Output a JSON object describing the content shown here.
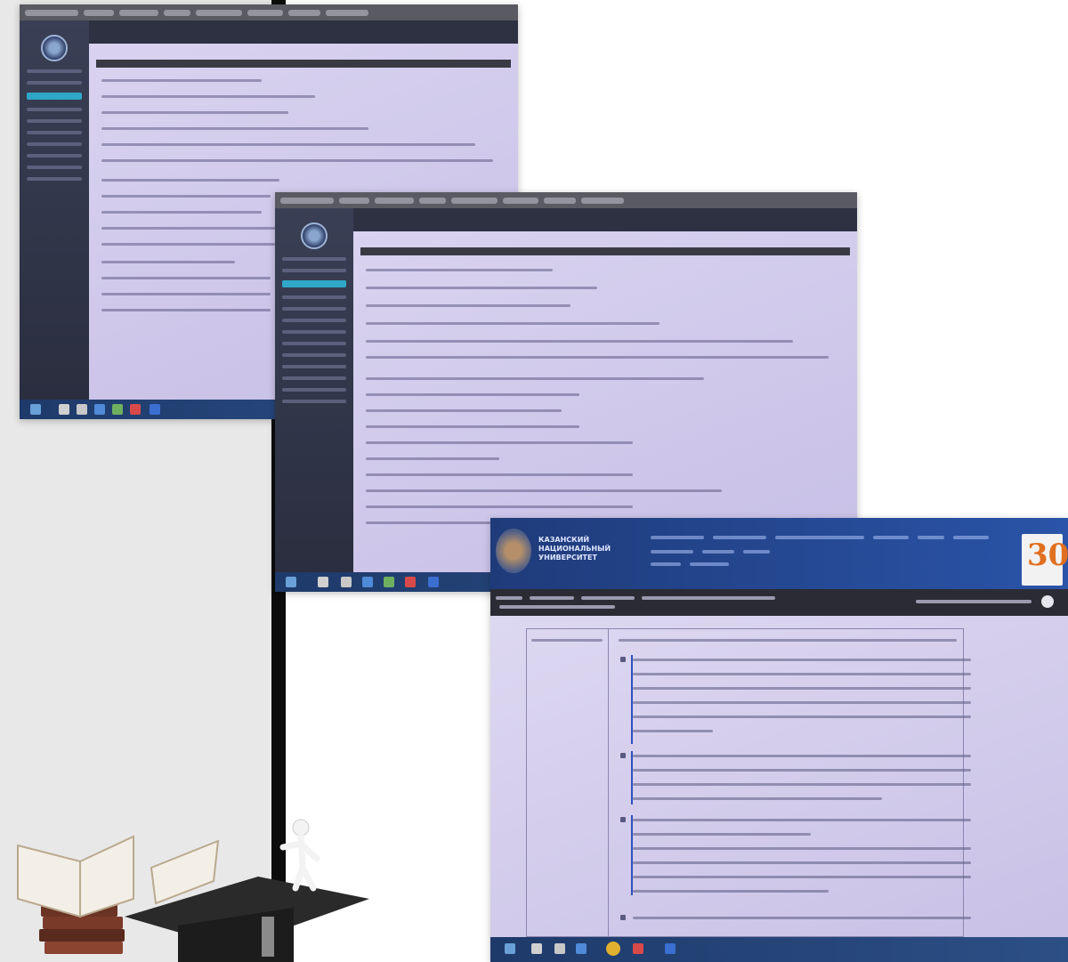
{
  "screens": [
    {
      "type": "lms-page",
      "browser_tabs": 8
    },
    {
      "type": "lms-page",
      "browser_tabs": 8
    },
    {
      "type": "university-site",
      "header": {
        "name_line1": "КАЗАНСКИЙ",
        "name_line2": "НАЦИОНАЛЬНЫЙ",
        "name_line3": "УНИВЕРСИТЕТ",
        "anniversary_number": "30"
      }
    }
  ],
  "colors": {
    "screen_tint": "#cdc6ea",
    "uni_header": "#1f3b7a",
    "taskbar": "#1e3a6a",
    "anniversary": "#e07020"
  },
  "icons": [
    "book-stack-icon",
    "graduation-cap-icon",
    "figure-icon"
  ]
}
